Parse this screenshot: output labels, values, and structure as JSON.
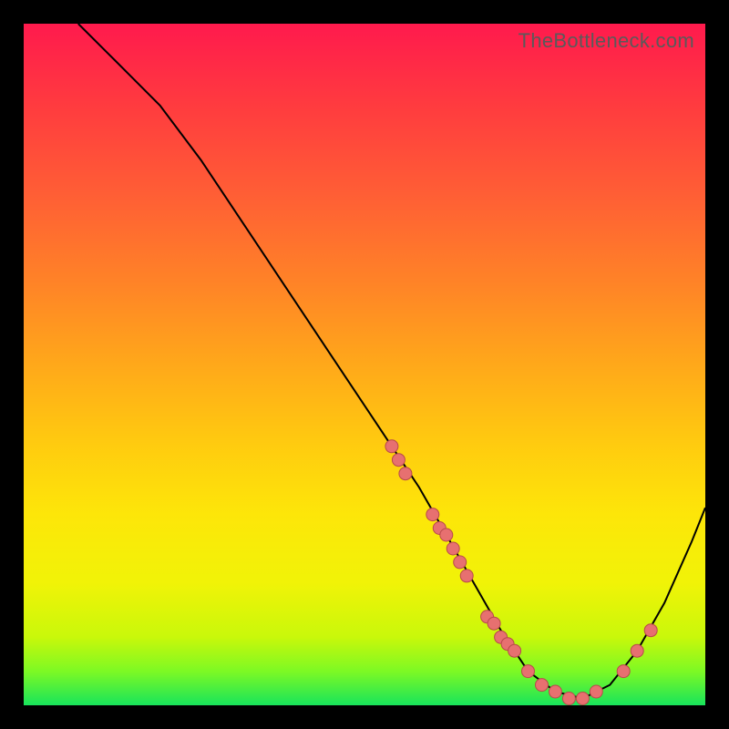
{
  "watermark": "TheBottleneck.com",
  "chart_data": {
    "type": "line",
    "title": "",
    "xlabel": "",
    "ylabel": "",
    "xlim": [
      0,
      100
    ],
    "ylim": [
      0,
      100
    ],
    "curve": {
      "x": [
        8,
        12,
        16,
        20,
        26,
        32,
        38,
        44,
        50,
        54,
        58,
        62,
        66,
        70,
        74,
        78,
        82,
        86,
        90,
        94,
        98,
        100
      ],
      "y": [
        100,
        96,
        92,
        88,
        80,
        71,
        62,
        53,
        44,
        38,
        32,
        25,
        18,
        11,
        5,
        2,
        1,
        3,
        8,
        15,
        24,
        29
      ]
    },
    "scatter_points": {
      "x": [
        54,
        55,
        56,
        60,
        61,
        62,
        63,
        64,
        65,
        68,
        69,
        70,
        71,
        72,
        74,
        76,
        78,
        80,
        82,
        84,
        88,
        90,
        92
      ],
      "y": [
        38,
        36,
        34,
        28,
        26,
        25,
        23,
        21,
        19,
        13,
        12,
        10,
        9,
        8,
        5,
        3,
        2,
        1,
        1,
        2,
        5,
        8,
        11
      ]
    },
    "colors": {
      "gradient_top": "#ff1a4d",
      "gradient_mid": "#ffcc0f",
      "gradient_bottom": "#18e45b",
      "curve": "#000000",
      "points_fill": "#e77070"
    }
  }
}
